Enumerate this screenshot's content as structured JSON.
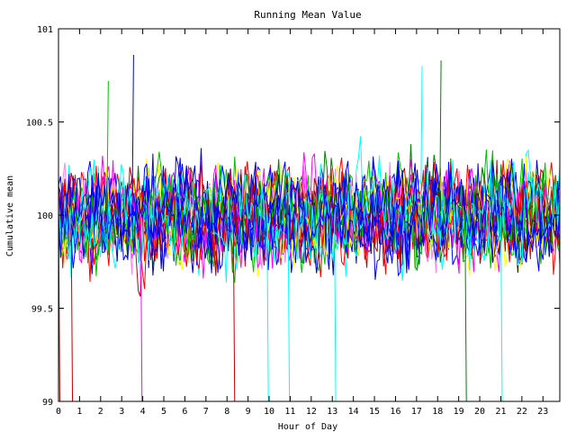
{
  "chart_data": {
    "type": "line",
    "title": "Running Mean Value",
    "xlabel": "Hour of Day",
    "ylabel": "Cumulative mean",
    "xlim": [
      0,
      23.8
    ],
    "ylim": [
      99,
      101
    ],
    "xticks": [
      "0",
      "1",
      "2",
      "3",
      "4",
      "5",
      "6",
      "7",
      "8",
      "9",
      "10",
      "11",
      "12",
      "13",
      "14",
      "15",
      "16",
      "17",
      "18",
      "19",
      "20",
      "21",
      "22",
      "23"
    ],
    "yticks": [
      "99",
      "99.5",
      "100",
      "100.5",
      "101"
    ],
    "grid": false,
    "legend": "none",
    "samples_per_series": 240,
    "series_center": 100,
    "series_spread": 0.22,
    "series_colors": [
      "#ff0000",
      "#00c000",
      "#0000ff",
      "#ff00ff",
      "#00ffff",
      "#ffff00",
      "#c00000",
      "#0000cc",
      "#008000",
      "#ff80ff"
    ],
    "series": [
      {
        "color": "#ff0000",
        "seed": 11
      },
      {
        "color": "#00c000",
        "seed": 23
      },
      {
        "color": "#0000ff",
        "seed": 37
      },
      {
        "color": "#ff00ff",
        "seed": 41
      },
      {
        "color": "#00ffff",
        "seed": 53
      },
      {
        "color": "#ffff00",
        "seed": 67
      },
      {
        "color": "#c00000",
        "seed": 71
      },
      {
        "color": "#0000cc",
        "seed": 83
      },
      {
        "color": "#008000",
        "seed": 97
      },
      {
        "color": "#ff80ff",
        "seed": 101
      },
      {
        "color": "#ff0000",
        "seed": 113
      },
      {
        "color": "#0000ff",
        "seed": 127
      },
      {
        "color": "#00c000",
        "seed": 131
      },
      {
        "color": "#00ffff",
        "seed": 149
      },
      {
        "color": "#0000ff",
        "seed": 157
      },
      {
        "color": "#ff00ff",
        "seed": 163
      },
      {
        "color": "#c00000",
        "seed": 173
      },
      {
        "color": "#0000ff",
        "seed": 181
      },
      {
        "color": "#ffff00",
        "seed": 191
      },
      {
        "color": "#ff0000",
        "seed": 199
      },
      {
        "color": "#00c000",
        "seed": 211
      },
      {
        "color": "#0000cc",
        "seed": 223
      },
      {
        "color": "#00ffff",
        "seed": 227
      },
      {
        "color": "#0000ff",
        "seed": 229
      }
    ],
    "spikes": [
      {
        "x": 0.0,
        "y": 99.0,
        "color": "#c00000"
      },
      {
        "x": 0.6,
        "y": 99.0,
        "color": "#c00000"
      },
      {
        "x": 3.9,
        "y": 99.0,
        "color": "#ff00ff"
      },
      {
        "x": 8.3,
        "y": 99.0,
        "color": "#c00000"
      },
      {
        "x": 9.9,
        "y": 99.0,
        "color": "#00ffff"
      },
      {
        "x": 10.9,
        "y": 99.0,
        "color": "#00ffff"
      },
      {
        "x": 13.1,
        "y": 99.0,
        "color": "#00ffff"
      },
      {
        "x": 19.3,
        "y": 99.0,
        "color": "#008000"
      },
      {
        "x": 21.0,
        "y": 99.0,
        "color": "#00ffff"
      },
      {
        "x": 3.5,
        "y": 100.86,
        "color": "#0000ff"
      },
      {
        "x": 18.1,
        "y": 100.83,
        "color": "#008000"
      },
      {
        "x": 17.2,
        "y": 100.8,
        "color": "#00ffff"
      },
      {
        "x": 2.3,
        "y": 100.72,
        "color": "#00c000"
      }
    ]
  }
}
